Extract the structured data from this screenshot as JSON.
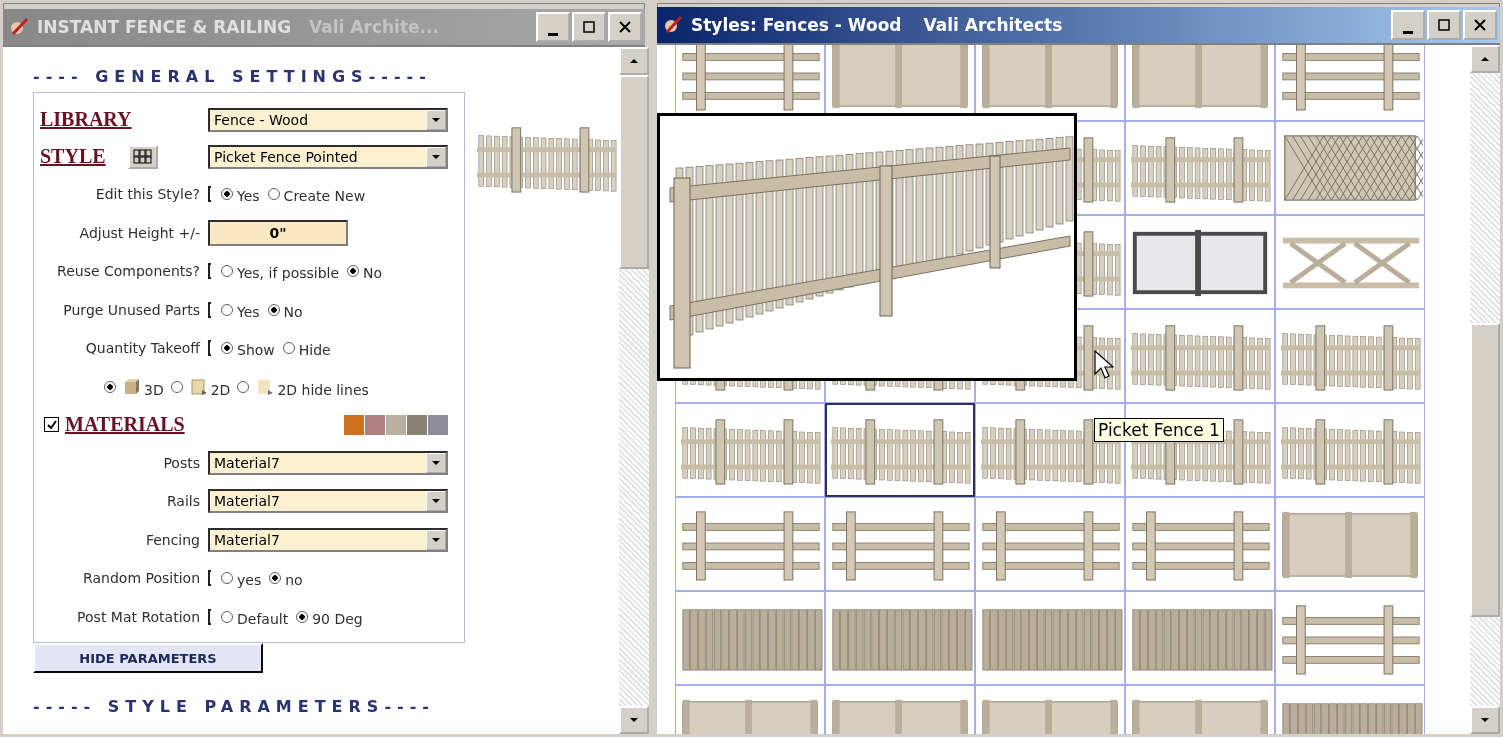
{
  "left_window": {
    "title": "INSTANT FENCE & RAILING",
    "subtitle": "Vali Archite...",
    "general_heading": "---- GENERAL SETTINGS-----",
    "library": {
      "label": "LIBRARY",
      "value": "Fence - Wood"
    },
    "style": {
      "label": "STYLE",
      "value": "Picket Fence Pointed"
    },
    "options_top": [
      {
        "kind": "radio",
        "label": "Edit this Style?",
        "choices": [
          {
            "label": "Yes",
            "selected": true
          },
          {
            "label": "Create New",
            "selected": false
          }
        ]
      },
      {
        "kind": "number",
        "label": "Adjust Height +/-",
        "value": "0\""
      },
      {
        "kind": "radio",
        "label": "Reuse Components?",
        "choices": [
          {
            "label": "Yes, if possible",
            "selected": false
          },
          {
            "label": "No",
            "selected": true
          }
        ]
      },
      {
        "kind": "radio",
        "label": "Purge Unused Parts",
        "choices": [
          {
            "label": "Yes",
            "selected": false
          },
          {
            "label": "No",
            "selected": true
          }
        ]
      },
      {
        "kind": "radio",
        "label": "Quantity Takeoff",
        "choices": [
          {
            "label": "Show",
            "selected": true
          },
          {
            "label": "Hide",
            "selected": false
          }
        ]
      }
    ],
    "view_modes": [
      {
        "kind": "solid",
        "label": "3D",
        "selected": true
      },
      {
        "kind": "flat",
        "label": "2D",
        "selected": false
      },
      {
        "kind": "faint",
        "label": "2D hide lines",
        "selected": false
      }
    ],
    "materials": {
      "label": "MATERIALS",
      "checked": true,
      "swatches": [
        {
          "color": "#d0701c"
        },
        {
          "color": "#b08080"
        },
        {
          "color": "#b8b0a0"
        },
        {
          "color": "#8a8270"
        },
        {
          "color": "#8e8c98"
        }
      ]
    },
    "material_fields": [
      {
        "label": "Posts",
        "value": "Material7"
      },
      {
        "label": "Rails",
        "value": "Material7"
      },
      {
        "label": "Fencing",
        "value": "Material7"
      }
    ],
    "options_bottom": [
      {
        "kind": "radio",
        "label": "Random Position",
        "choices": [
          {
            "label": "yes",
            "selected": false
          },
          {
            "label": "no",
            "selected": true
          }
        ]
      },
      {
        "kind": "radio",
        "label": "Post Mat Rotation",
        "choices": [
          {
            "label": "Default",
            "selected": false
          },
          {
            "label": "90 Deg",
            "selected": true
          }
        ]
      }
    ],
    "hide_button": "HIDE PARAMETERS",
    "style_heading": "----- STYLE PARAMETERS----"
  },
  "right_window": {
    "title": "Styles: Fences - Wood",
    "subtitle": "Vali Architects",
    "tooltip": "Picket Fence 1",
    "rows": [
      [
        {
          "kind": "rail",
          "selected": false
        },
        {
          "kind": "panel",
          "selected": false
        },
        {
          "kind": "panel",
          "selected": false
        },
        {
          "kind": "panel",
          "selected": false
        },
        {
          "kind": "rail",
          "selected": false
        }
      ],
      [
        {
          "kind": "picket",
          "selected": false
        },
        {
          "kind": "picket",
          "selected": false
        },
        {
          "kind": "lattice",
          "selected": false
        }
      ],
      [
        {
          "kind": "picket",
          "selected": false
        },
        {
          "kind": "chainlink",
          "selected": false
        },
        {
          "kind": "cross",
          "selected": false
        }
      ],
      [
        {
          "kind": "picket",
          "selected": false
        },
        {
          "kind": "picket",
          "selected": false
        },
        {
          "kind": "picket",
          "selected": false
        },
        {
          "kind": "picket",
          "selected": false
        },
        {
          "kind": "picket",
          "selected": false
        }
      ],
      [
        {
          "kind": "picket",
          "selected": false
        },
        {
          "kind": "picket",
          "selected": true
        },
        {
          "kind": "picket",
          "selected": false
        },
        {
          "kind": "picket",
          "selected": false
        },
        {
          "kind": "picket",
          "selected": false
        }
      ],
      [
        {
          "kind": "rail",
          "selected": false
        },
        {
          "kind": "rail",
          "selected": false
        },
        {
          "kind": "rail",
          "selected": false
        },
        {
          "kind": "rail",
          "selected": false
        },
        {
          "kind": "panel",
          "selected": false
        }
      ],
      [
        {
          "kind": "boards",
          "selected": false
        },
        {
          "kind": "boards",
          "selected": false
        },
        {
          "kind": "boards",
          "selected": false
        },
        {
          "kind": "boards",
          "selected": false
        },
        {
          "kind": "rail",
          "selected": false
        }
      ],
      [
        {
          "kind": "panel",
          "selected": false
        },
        {
          "kind": "panel",
          "selected": false
        },
        {
          "kind": "panel",
          "selected": false
        },
        {
          "kind": "panel",
          "selected": false
        },
        {
          "kind": "boards",
          "selected": false
        }
      ]
    ]
  }
}
